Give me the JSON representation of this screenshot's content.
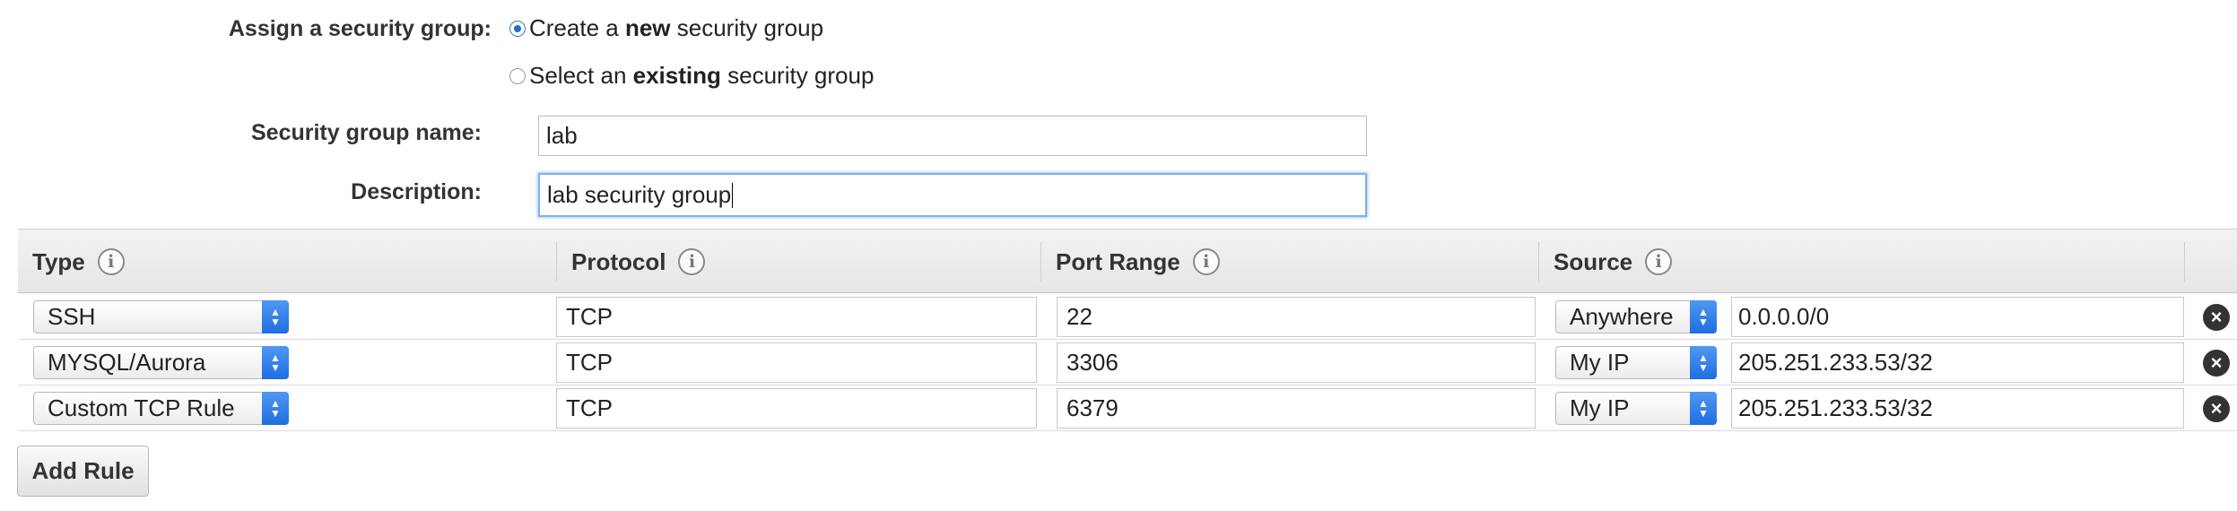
{
  "security_group": {
    "assign_label": "Assign a security group:",
    "options": [
      {
        "prefix": "Create a ",
        "bold": "new",
        "suffix": " security group",
        "selected": true
      },
      {
        "prefix": "Select an ",
        "bold": "existing",
        "suffix": " security group",
        "selected": false
      }
    ],
    "name_label": "Security group name:",
    "name_value": "lab",
    "description_label": "Description:",
    "description_value": "lab security group"
  },
  "rules_table": {
    "headers": {
      "type": "Type",
      "protocol": "Protocol",
      "port_range": "Port Range",
      "source": "Source"
    },
    "rows": [
      {
        "type": "SSH",
        "protocol": "TCP",
        "port_range": "22",
        "source_type": "Anywhere",
        "source_value": "0.0.0.0/0"
      },
      {
        "type": "MYSQL/Aurora",
        "protocol": "TCP",
        "port_range": "3306",
        "source_type": "My IP",
        "source_value": "205.251.233.53/32"
      },
      {
        "type": "Custom TCP Rule",
        "protocol": "TCP",
        "port_range": "6379",
        "source_type": "My IP",
        "source_value": "205.251.233.53/32"
      }
    ]
  },
  "add_rule_label": "Add Rule",
  "icons": {
    "info": "info-icon",
    "remove": "close-circle-icon",
    "select_arrow": "chevron-up-down-icon"
  },
  "colors": {
    "accent": "#1f6ee0",
    "focus": "#7bb2ea"
  }
}
